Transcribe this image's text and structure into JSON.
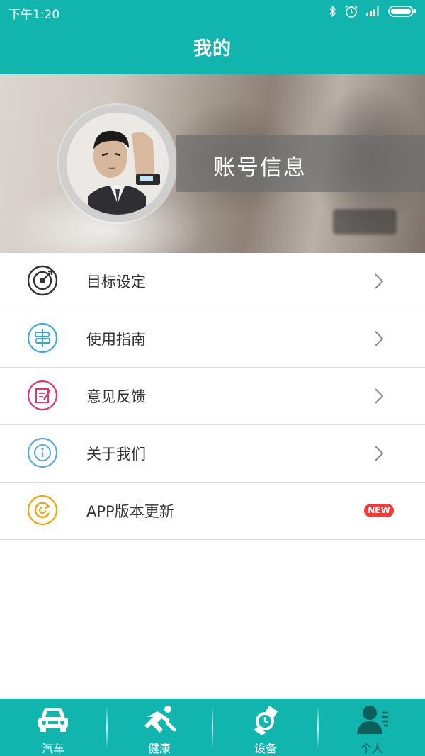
{
  "status_bar": {
    "time": "下午1:20",
    "icons": [
      "bluetooth-icon",
      "alarm-icon",
      "signal-icon",
      "battery-icon"
    ]
  },
  "header": {
    "title": "我的"
  },
  "banner": {
    "account_label": "账号信息"
  },
  "menu": {
    "items": [
      {
        "label": "目标设定",
        "icon": "target-icon",
        "color": "#333333"
      },
      {
        "label": "使用指南",
        "icon": "signpost-icon",
        "color": "#3aa7d6"
      },
      {
        "label": "意见反馈",
        "icon": "feedback-icon",
        "color": "#e0357a"
      },
      {
        "label": "关于我们",
        "icon": "info-icon",
        "color": "#5aa9d9"
      },
      {
        "label": "APP版本更新",
        "icon": "update-icon",
        "color": "#f2a400",
        "badge": "NEW"
      }
    ]
  },
  "tabbar": {
    "tabs": [
      {
        "label": "汽车",
        "icon": "car-icon"
      },
      {
        "label": "健康",
        "icon": "runner-icon"
      },
      {
        "label": "设备",
        "icon": "watch-icon"
      },
      {
        "label": "个人",
        "icon": "person-icon",
        "active": true
      }
    ]
  },
  "colors": {
    "primary": "#12b5ad",
    "badge": "#ef3b3b",
    "active_tab_label": "#0c5e5a"
  }
}
